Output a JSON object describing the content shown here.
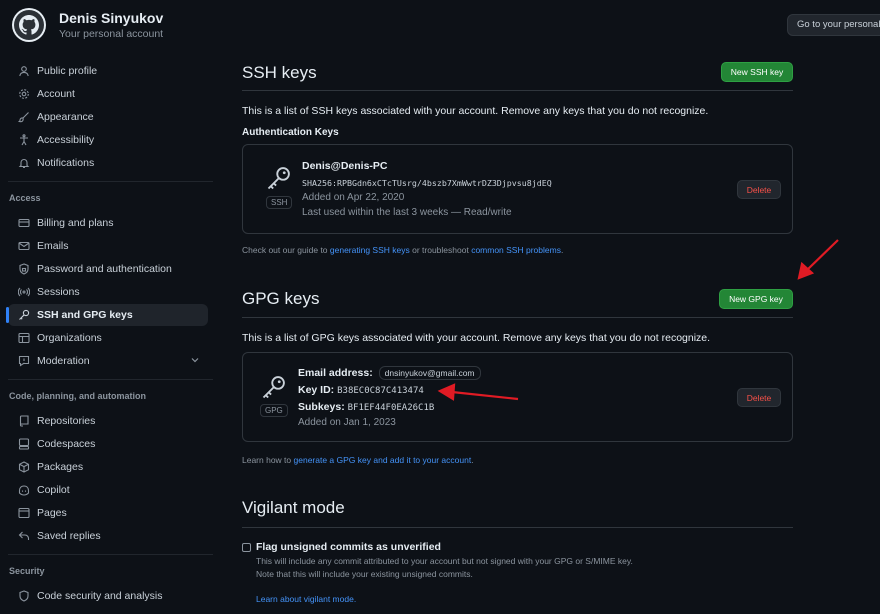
{
  "header": {
    "user_name": "Denis Sinyukov",
    "user_subtitle": "Your personal account",
    "goto_button": "Go to your personal p"
  },
  "sidebar": {
    "items_top": [
      {
        "label": "Public profile",
        "icon": "person-icon"
      },
      {
        "label": "Account",
        "icon": "gear-icon"
      },
      {
        "label": "Appearance",
        "icon": "paintbrush-icon"
      },
      {
        "label": "Accessibility",
        "icon": "accessibility-icon"
      },
      {
        "label": "Notifications",
        "icon": "bell-icon"
      }
    ],
    "access_title": "Access",
    "items_access": [
      {
        "label": "Billing and plans",
        "icon": "credit-card-icon"
      },
      {
        "label": "Emails",
        "icon": "mail-icon"
      },
      {
        "label": "Password and authentication",
        "icon": "shield-lock-icon"
      },
      {
        "label": "Sessions",
        "icon": "broadcast-icon"
      },
      {
        "label": "SSH and GPG keys",
        "icon": "key-icon",
        "active": true
      },
      {
        "label": "Organizations",
        "icon": "table-icon"
      },
      {
        "label": "Moderation",
        "icon": "report-icon"
      }
    ],
    "code_title": "Code, planning, and automation",
    "items_code": [
      {
        "label": "Repositories",
        "icon": "repo-icon"
      },
      {
        "label": "Codespaces",
        "icon": "codespaces-icon"
      },
      {
        "label": "Packages",
        "icon": "package-icon"
      },
      {
        "label": "Copilot",
        "icon": "copilot-icon"
      },
      {
        "label": "Pages",
        "icon": "browser-icon"
      },
      {
        "label": "Saved replies",
        "icon": "reply-icon"
      }
    ],
    "security_title": "Security",
    "items_security": [
      {
        "label": "Code security and analysis",
        "icon": "shield-icon"
      }
    ]
  },
  "ssh": {
    "title": "SSH keys",
    "new_button": "New SSH key",
    "description": "This is a list of SSH keys associated with your account. Remove any keys that you do not recognize.",
    "auth_title": "Authentication Keys",
    "key": {
      "name": "Denis@Denis-PC",
      "fingerprint": "SHA256:RPBGdn6xCTcTUsrg/4bszb7XmWwtrDZ3Djpvsu8jdEQ",
      "added": "Added on Apr 22, 2020",
      "last_used": "Last used within the last 3 weeks — Read/write",
      "badge": "SSH",
      "delete": "Delete"
    },
    "footer_prefix": "Check out our guide to ",
    "footer_link1": "generating SSH keys",
    "footer_mid": " or troubleshoot ",
    "footer_link2": "common SSH problems",
    "footer_suffix": "."
  },
  "gpg": {
    "title": "GPG keys",
    "new_button": "New GPG key",
    "description": "This is a list of GPG keys associated with your account. Remove any keys that you do not recognize.",
    "key": {
      "email_label": "Email address:",
      "email": "dnsinyukov@gmail.com",
      "keyid_label": "Key ID:",
      "keyid": "B38EC0C87C413474",
      "subkeys_label": "Subkeys:",
      "subkeys": "BF1EF44F0EA26C1B",
      "added": "Added on Jan 1, 2023",
      "badge": "GPG",
      "delete": "Delete"
    },
    "footer_prefix": "Learn how to ",
    "footer_link": "generate a GPG key and add it to your account",
    "footer_suffix": "."
  },
  "vigilant": {
    "title": "Vigilant mode",
    "checkbox_label": "Flag unsigned commits as unverified",
    "help_line1": "This will include any commit attributed to your account but not signed with your GPG or S/MIME key.",
    "help_line2": "Note that this will include your existing unsigned commits.",
    "learn_link": "Learn about vigilant mode."
  },
  "colors": {
    "background": "#0d1117",
    "accent_green": "#238636",
    "link_blue": "#4493f8",
    "danger_red": "#f85149",
    "annotation_red": "#e01b24"
  }
}
